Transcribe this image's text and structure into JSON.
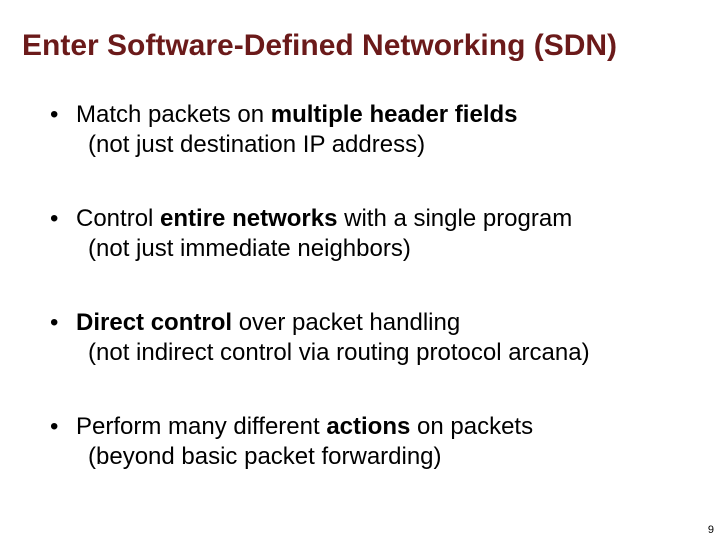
{
  "title": "Enter Software-Defined Networking (SDN)",
  "bullets": [
    {
      "pre1": "Match packets on ",
      "bold1": "multiple header fields",
      "post1": "",
      "sub": "(not just destination IP address)"
    },
    {
      "pre1": "Control ",
      "bold1": "entire networks",
      "post1": " with a single program",
      "sub": "(not just immediate neighbors)"
    },
    {
      "pre1": "",
      "bold1": "Direct control",
      "post1": " over packet handling",
      "sub": "(not indirect control via routing protocol arcana)"
    },
    {
      "pre1": "Perform many different ",
      "bold1": "actions",
      "post1": " on packets",
      "sub": "(beyond basic packet forwarding)"
    }
  ],
  "page_number": "9"
}
